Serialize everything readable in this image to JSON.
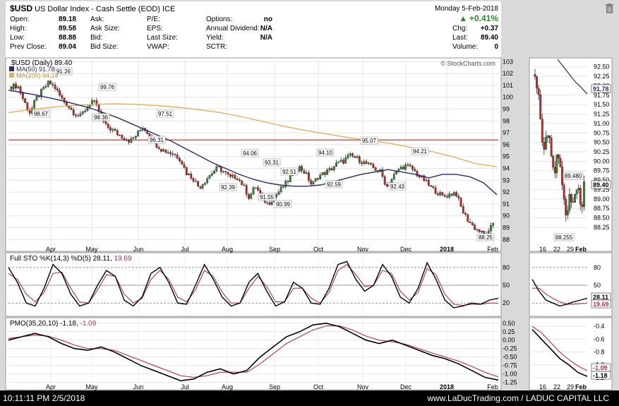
{
  "header": {
    "symbol": "$USD",
    "name": "US Dollar Index - Cash Settle (EOD)",
    "exchange": "ICE",
    "date": "Monday  5-Feb-2018",
    "change_pct": "+0.41%",
    "quote": [
      {
        "label": "Open:",
        "value": "89.18"
      },
      {
        "label": "High:",
        "value": "89.58"
      },
      {
        "label": "Low:",
        "value": "88.88"
      },
      {
        "label": "Prev Close:",
        "value": "89.04"
      }
    ],
    "bid": [
      {
        "label": "Ask:",
        "value": ""
      },
      {
        "label": "Ask Size:",
        "value": ""
      },
      {
        "label": "Bid:",
        "value": ""
      },
      {
        "label": "Bid Size:",
        "value": ""
      }
    ],
    "fund": [
      {
        "label": "P/E:",
        "value": ""
      },
      {
        "label": "EPS:",
        "value": ""
      },
      {
        "label": "Last Size:",
        "value": ""
      },
      {
        "label": "VWAP:",
        "value": ""
      }
    ],
    "opts": [
      {
        "label": "Options:",
        "value": "no"
      },
      {
        "label": "Annual Dividend:",
        "value": "N/A"
      },
      {
        "label": "Yield:",
        "value": "N/A"
      },
      {
        "label": "SCTR:",
        "value": ""
      }
    ],
    "right": [
      {
        "label": "Chg:",
        "value": "+0.37"
      },
      {
        "label": "Last:",
        "value": "89.40"
      },
      {
        "label": "Volume:",
        "value": "0"
      }
    ],
    "watermark": "© StockCharts.com"
  },
  "colors": {
    "up": "#2e8b2e",
    "down": "#cc2222",
    "ma50": "#2b2b6e",
    "ma200": "#e0b060",
    "support": "#cc2222",
    "stoK": "#000000",
    "stoD": "#b03060",
    "pmo": "#000000",
    "pmoSig": "#b03060"
  },
  "legend": {
    "main": "$USD (Daily) 89.40",
    "ma50": "MA(50) 91.78",
    "ma200": "MA(200) 94.14",
    "sto_label": "Full STO %K(14,3) %D(5) 28.11, ",
    "sto_d": "19.69",
    "pmo_label": "PMO(35,20,10) -1.18, ",
    "pmo_sig": "-1.09"
  },
  "badges": {
    "last": "89.40",
    "ma50": "91.78",
    "sto_k": "28.11",
    "sto_d": "19.69",
    "pmo": "-1.09",
    "pmo_sig": "-1.18"
  },
  "footer": {
    "timestamp": "10:11:11 PM 2/5/2018",
    "credit": "www.LaDucTrading.com / LADUC CAPITAL LLC"
  },
  "chart_data": {
    "type": "candlestick",
    "price_axis": {
      "ylim": [
        87.6,
        103.2
      ],
      "ticks": [
        88,
        89,
        90,
        91,
        92,
        93,
        94,
        95,
        96,
        97,
        98,
        99,
        100,
        101,
        102,
        103
      ]
    },
    "month_labels": [
      "Apr",
      "May",
      "Jun",
      "Jul",
      "Aug",
      "Sep",
      "Oct",
      "Nov",
      "Dec",
      "2018",
      "Feb"
    ],
    "support_level": 96.4,
    "price_path": [
      100.9,
      101.0,
      99.7,
      98.67,
      99.9,
      100.6,
      101.26,
      100.8,
      99.9,
      99.3,
      98.7,
      98.36,
      99.1,
      99.76,
      98.8,
      97.6,
      97.3,
      96.9,
      96.6,
      96.31,
      96.8,
      97.51,
      96.9,
      96.1,
      95.6,
      95.4,
      95.2,
      94.8,
      93.6,
      93.2,
      92.39,
      93.0,
      93.6,
      94.06,
      93.7,
      93.2,
      93.31,
      92.6,
      91.55,
      92.51,
      91.6,
      90.99,
      91.6,
      92.2,
      92.8,
      93.6,
      94.1,
      93.6,
      92.59,
      93.3,
      93.6,
      93.9,
      94.4,
      94.6,
      95.07,
      94.9,
      94.6,
      94.3,
      94.0,
      93.7,
      92.43,
      93.3,
      94.0,
      94.21,
      94.0,
      93.4,
      93.0,
      92.4,
      92.0,
      91.6,
      91.8,
      92.0,
      90.5,
      89.6,
      89.0,
      88.6,
      88.25,
      89.4
    ],
    "ma50": [
      100.6,
      100.4,
      100.2,
      99.95,
      99.7,
      99.4,
      99.1,
      98.7,
      98.3,
      97.8,
      97.3,
      96.8,
      96.3,
      95.7,
      95.1,
      94.5,
      94.0,
      93.5,
      93.1,
      92.8,
      92.6,
      92.5,
      92.5,
      92.6,
      92.9,
      93.2,
      93.5,
      93.7,
      93.9,
      93.7,
      93.5,
      93.2,
      93.5,
      93.5,
      93.3,
      92.8,
      91.78
    ],
    "ma200": [
      98.7,
      98.95,
      99.15,
      99.3,
      99.4,
      99.45,
      99.4,
      99.3,
      99.15,
      98.95,
      98.7,
      98.35,
      97.95,
      97.55,
      97.2,
      96.9,
      96.6,
      96.35,
      96.1,
      95.75,
      95.4,
      94.95,
      94.4,
      94.14
    ],
    "price_labels": [
      {
        "value": "91.26"
      },
      {
        "value": "98.67"
      },
      {
        "value": "99.76"
      },
      {
        "value": "98.36"
      },
      {
        "value": "97.51"
      },
      {
        "value": "96.31"
      },
      {
        "value": "94.06"
      },
      {
        "value": "93.31"
      },
      {
        "value": "92.51"
      },
      {
        "value": "92.39"
      },
      {
        "value": "91.55"
      },
      {
        "value": "90.99"
      },
      {
        "value": "94.10"
      },
      {
        "value": "95.07"
      },
      {
        "value": "92.59"
      },
      {
        "value": "94.21"
      },
      {
        "value": "92.43"
      },
      {
        "value": "88.25"
      }
    ],
    "sto_axis": {
      "ylim": [
        0,
        100
      ],
      "ticks": [
        20,
        50,
        80
      ]
    },
    "sto_k": [
      80,
      55,
      20,
      15,
      45,
      85,
      70,
      35,
      15,
      20,
      50,
      75,
      65,
      25,
      15,
      30,
      70,
      80,
      55,
      20,
      18,
      50,
      85,
      60,
      30,
      15,
      20,
      55,
      70,
      40,
      15,
      22,
      55,
      45,
      20,
      18,
      45,
      85,
      90,
      60,
      40,
      50,
      85,
      65,
      30,
      20,
      45,
      88,
      60,
      25,
      12,
      15,
      20,
      18,
      25,
      28.11
    ],
    "sto_d": [
      70,
      60,
      35,
      22,
      38,
      70,
      72,
      45,
      22,
      20,
      42,
      68,
      65,
      35,
      20,
      28,
      60,
      75,
      60,
      30,
      22,
      42,
      75,
      65,
      38,
      20,
      20,
      45,
      65,
      48,
      22,
      22,
      45,
      45,
      28,
      20,
      38,
      75,
      85,
      68,
      48,
      50,
      75,
      70,
      40,
      25,
      38,
      78,
      68,
      35,
      18,
      16,
      18,
      18,
      20,
      19.69
    ],
    "pmo_axis": {
      "ylim": [
        -1.3,
        0.6
      ],
      "ticks": [
        0.5,
        0.25,
        0.0,
        -0.25,
        -0.5,
        -0.75,
        -1.0,
        -1.25
      ]
    },
    "pmo": [
      0.0,
      0.1,
      0.2,
      0.1,
      -0.1,
      -0.25,
      -0.3,
      -0.2,
      -0.35,
      -0.55,
      -0.75,
      -0.9,
      -1.05,
      -1.2,
      -1.15,
      -0.95,
      -0.85,
      -1.0,
      -0.9,
      -0.5,
      -0.2,
      0.1,
      0.25,
      0.45,
      0.5,
      0.4,
      0.2,
      0.0,
      -0.1,
      0.0,
      -0.15,
      -0.3,
      -0.45,
      -0.55,
      -0.7,
      -0.9,
      -1.1,
      -1.18
    ],
    "pmo_signal": [
      0.05,
      0.1,
      0.15,
      0.12,
      0.0,
      -0.15,
      -0.25,
      -0.25,
      -0.3,
      -0.45,
      -0.6,
      -0.75,
      -0.9,
      -1.05,
      -1.1,
      -1.05,
      -0.95,
      -0.95,
      -0.95,
      -0.7,
      -0.4,
      -0.1,
      0.1,
      0.3,
      0.42,
      0.42,
      0.3,
      0.12,
      0.0,
      -0.05,
      -0.12,
      -0.25,
      -0.38,
      -0.5,
      -0.62,
      -0.78,
      -0.95,
      -1.09
    ],
    "detail": {
      "price_axis": {
        "ylim": [
          87.8,
          92.7
        ],
        "ticks": [
          88.25,
          88.5,
          88.75,
          89.0,
          89.25,
          89.5,
          89.75,
          90.0,
          90.25,
          90.5,
          90.75,
          91.0,
          91.25,
          91.5,
          91.75,
          92.0,
          92.25,
          92.5
        ]
      },
      "x_labels": [
        "16",
        "22",
        "29",
        "Feb"
      ],
      "price_path": [
        92.3,
        91.9,
        91.0,
        90.1,
        90.8,
        90.7,
        90.0,
        89.8,
        90.3,
        89.9,
        89.0,
        88.5,
        89.2,
        88.8,
        89.3,
        89.48,
        88.6,
        89.4
      ],
      "ma50": [
        92.7,
        92.5,
        92.3,
        92.1,
        91.95,
        91.78
      ],
      "labels": [
        {
          "value": "89.480"
        },
        {
          "value": "88.255"
        }
      ],
      "sto_k": [
        60,
        40,
        25,
        20,
        15,
        18,
        22,
        25,
        28.11
      ],
      "sto_d": [
        45,
        45,
        35,
        28,
        22,
        18,
        18,
        19,
        19.69
      ],
      "sto_ticks": [
        20,
        50,
        80
      ],
      "pmo": [
        -0.45,
        -0.6,
        -0.75,
        -0.9,
        -1.0,
        -1.12,
        -1.18
      ],
      "pmo_signal": [
        -0.4,
        -0.5,
        -0.65,
        -0.8,
        -0.92,
        -1.02,
        -1.09
      ],
      "pmo_ticks": [
        -0.4,
        -0.6,
        -0.8,
        -1.0,
        -1.2
      ]
    }
  }
}
